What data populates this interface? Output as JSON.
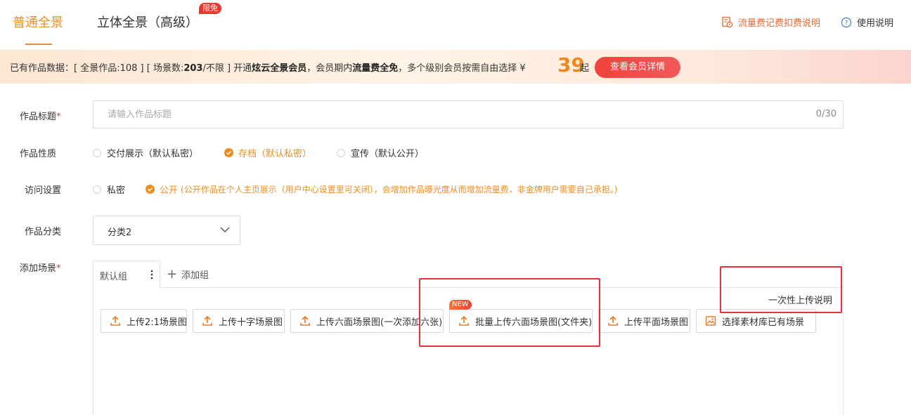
{
  "tabs": {
    "normal": "普通全景",
    "stereo": "立体全景（高级）",
    "free_badge": "限免"
  },
  "top_links": {
    "fee": "流量费记费扣费说明",
    "help": "使用说明"
  },
  "banner": {
    "prefix": "已有作品数据：[ 全景作品:108 ] [ 场景数:",
    "scene_count": "203",
    "limit": "/不限 ] 开通",
    "member": "炫云全景会员",
    "mid": "，会员期内",
    "free_fee": "流量费全免",
    "tail": "，多个级别会员按需自由选择 ¥",
    "price": "39",
    "price_suffix": "起",
    "button": "查看会员详情"
  },
  "form": {
    "title_label": "作品标题",
    "title_placeholder": "请输入作品标题",
    "title_count": "0/30",
    "nature_label": "作品性质",
    "nature_options": [
      "交付展示（默认私密）",
      "存档（默认私密）",
      "宣传（默认公开）"
    ],
    "nature_selected": 1,
    "access_label": "访问设置",
    "access_private": "私密",
    "access_public": "公开",
    "access_note": "(公开作品在个人主页展示（用户中心设置里可关闭），会增加作品曝光度从而增加流量费，非金牌用户需要自己承担。)",
    "category_label": "作品分类",
    "category_value": "分类2",
    "scene_label": "添加场景"
  },
  "scenes": {
    "default_group": "默认组",
    "add_group": "添加组",
    "once_upload_help": "一次性上传说明",
    "new_badge": "NEW",
    "buttons": [
      "上传2:1场景图",
      "上传十字场景图",
      "上传六面场景图(一次添加六张)",
      "批量上传六面场景图(文件夹)",
      "上传平面场景图",
      "选择素材库已有场景"
    ]
  },
  "colors": {
    "accent": "#f08c1e",
    "highlight_box": "#e8303a"
  }
}
